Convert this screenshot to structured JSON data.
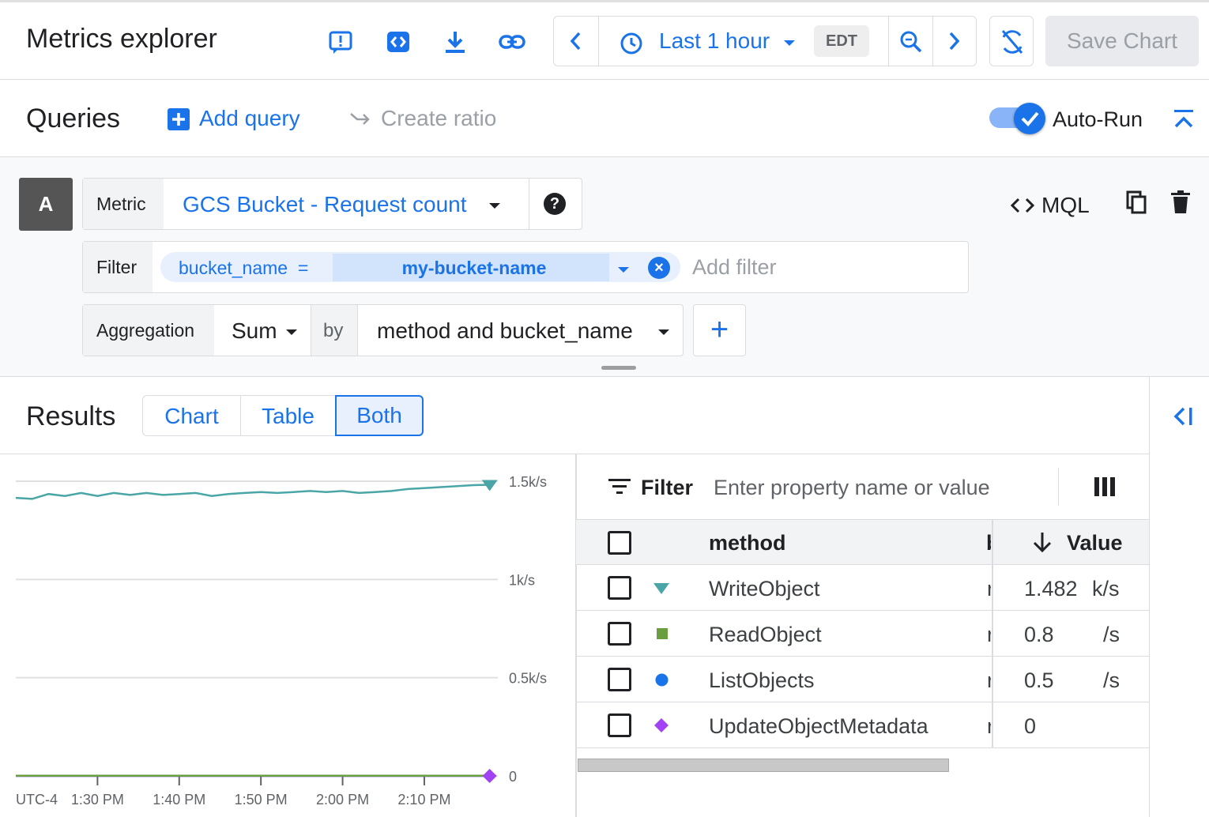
{
  "header": {
    "title": "Metrics explorer",
    "time_range": "Last 1 hour",
    "timezone": "EDT",
    "save_label": "Save Chart"
  },
  "queries": {
    "title": "Queries",
    "add_query": "Add query",
    "create_ratio": "Create ratio",
    "autorun_label": "Auto-Run",
    "autorun_on": true
  },
  "query": {
    "id": "A",
    "metric_label": "Metric",
    "metric_value": "GCS Bucket - Request count",
    "mql_label": "MQL",
    "filter_label": "Filter",
    "filter_key": "bucket_name",
    "filter_op": "=",
    "filter_value": "my-bucket-name",
    "add_filter_placeholder": "Add filter",
    "aggregation_label": "Aggregation",
    "aggregation_value": "Sum",
    "by_label": "by",
    "group_by_value": "method and bucket_name"
  },
  "results": {
    "title": "Results",
    "view_options": [
      "Chart",
      "Table",
      "Both"
    ],
    "selected_view": "Both"
  },
  "table": {
    "filter_label": "Filter",
    "filter_placeholder": "Enter property name or value",
    "columns": [
      "method",
      "Value"
    ],
    "rows": [
      {
        "method": "WriteObject",
        "value": "1.482",
        "unit": "k/s",
        "marker": "triangle",
        "color": "#4aa6a6"
      },
      {
        "method": "ReadObject",
        "value": "0.8",
        "unit": "/s",
        "marker": "square",
        "color": "#6a9e3f"
      },
      {
        "method": "ListObjects",
        "value": "0.5",
        "unit": "/s",
        "marker": "circle",
        "color": "#1a73e8"
      },
      {
        "method": "UpdateObjectMetadata",
        "value": "0",
        "unit": "",
        "marker": "diamond",
        "color": "#a142f4"
      }
    ]
  },
  "chart_data": {
    "type": "line",
    "x": [
      "13:20",
      "13:22",
      "13:24",
      "13:26",
      "13:28",
      "13:30",
      "13:32",
      "13:34",
      "13:36",
      "13:38",
      "13:40",
      "13:42",
      "13:44",
      "13:46",
      "13:48",
      "13:50",
      "13:52",
      "13:54",
      "13:56",
      "13:58",
      "14:00",
      "14:02",
      "14:04",
      "14:06",
      "14:08",
      "14:10",
      "14:12",
      "14:14",
      "14:16",
      "14:18"
    ],
    "x_ticks": [
      "1:30 PM",
      "1:40 PM",
      "1:50 PM",
      "2:00 PM",
      "2:10 PM"
    ],
    "x_tick_values": [
      "13:30",
      "13:40",
      "13:50",
      "14:00",
      "14:10"
    ],
    "x_start": "13:20",
    "x_end": "14:19",
    "x_origin_label": "UTC-4",
    "y_ticks": [
      "1.5k/s",
      "1k/s",
      "0.5k/s",
      "0"
    ],
    "y_tick_values": [
      1500,
      1000,
      500,
      0
    ],
    "ylim": [
      0,
      1500
    ],
    "series": [
      {
        "name": "WriteObject",
        "color": "#4aa6a6",
        "values": [
          1415,
          1410,
          1435,
          1425,
          1440,
          1425,
          1440,
          1430,
          1440,
          1430,
          1435,
          1440,
          1425,
          1435,
          1440,
          1445,
          1440,
          1445,
          1450,
          1445,
          1450,
          1440,
          1445,
          1450,
          1460,
          1465,
          1470,
          1475,
          1480,
          1482
        ]
      },
      {
        "name": "ReadObject",
        "color": "#6a9e3f",
        "values": [
          0.8,
          0.8,
          0.8,
          0.8,
          0.8,
          0.8,
          0.8,
          0.8,
          0.8,
          0.8,
          0.8,
          0.8,
          0.8,
          0.8,
          0.8,
          0.8,
          0.8,
          0.8,
          0.8,
          0.8,
          0.8,
          0.8,
          0.8,
          0.8,
          0.8,
          0.8,
          0.8,
          0.8,
          0.8,
          0.8
        ]
      },
      {
        "name": "ListObjects",
        "color": "#1a73e8",
        "values": [
          0.5,
          0.5,
          0.5,
          0.5,
          0.5,
          0.5,
          0.5,
          0.5,
          0.5,
          0.5,
          0.5,
          0.5,
          0.5,
          0.5,
          0.5,
          0.5,
          0.5,
          0.5,
          0.5,
          0.5,
          0.5,
          0.5,
          0.5,
          0.5,
          0.5,
          0.5,
          0.5,
          0.5,
          0.5,
          0.5
        ]
      },
      {
        "name": "UpdateObjectMetadata",
        "color": "#a142f4",
        "values": [
          0,
          0,
          0,
          0,
          0,
          0,
          0,
          0,
          0,
          0,
          0,
          0,
          0,
          0,
          0,
          0,
          0,
          0,
          0,
          0,
          0,
          0,
          0,
          0,
          0,
          0,
          0,
          0,
          0,
          0
        ]
      }
    ],
    "grid": true
  }
}
